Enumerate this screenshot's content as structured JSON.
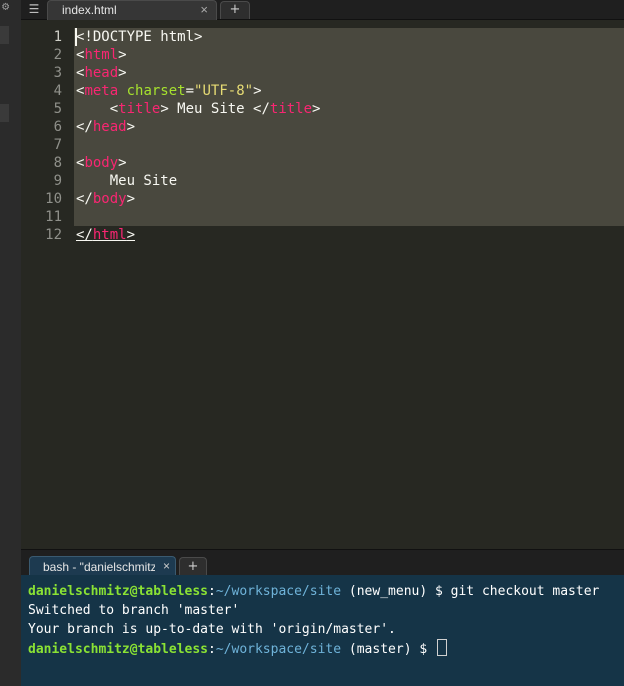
{
  "editor": {
    "tab_label": "index.html",
    "tab_close": "×",
    "new_tab": "+",
    "line_numbers": [
      "1",
      "2",
      "3",
      "4",
      "5",
      "6",
      "7",
      "8",
      "9",
      "10",
      "11",
      "12"
    ],
    "lines": {
      "l1": "<!DOCTYPE html>",
      "l2": {
        "open": "<",
        "tag": "html",
        "close": ">"
      },
      "l3": {
        "open": "<",
        "tag": "head",
        "close": ">"
      },
      "l4": {
        "open": "<",
        "tag": "meta",
        "sp": " ",
        "attr": "charset",
        "eq": "=",
        "str": "\"UTF-8\"",
        "close": ">"
      },
      "l5": {
        "indent": "    ",
        "open": "<",
        "tag": "title",
        "mid": "> Meu Site </",
        "tag2": "title",
        "close": ">"
      },
      "l6": {
        "open": "</",
        "tag": "head",
        "close": ">"
      },
      "l8": {
        "open": "<",
        "tag": "body",
        "close": ">"
      },
      "l9": "    Meu Site",
      "l10": {
        "open": "</",
        "tag": "body",
        "close": ">"
      },
      "l12": {
        "open": "</",
        "tag": "html",
        "close": ">"
      }
    }
  },
  "terminal": {
    "tab_label": "bash - \"danielschmitz",
    "tab_close": "×",
    "new_tab": "+",
    "lines": [
      {
        "user": "danielschmitz@tableless",
        "sep": ":",
        "path": "~/workspace/site",
        "rest": " (new_menu) $ git checkout master"
      },
      {
        "text": "Switched to branch 'master'"
      },
      {
        "text": "Your branch is up-to-date with 'origin/master'."
      },
      {
        "user": "danielschmitz@tableless",
        "sep": ":",
        "path": "~/workspace/site",
        "rest": " (master) $ "
      }
    ]
  },
  "colors": {
    "editor_bg": "#272822",
    "selection": "#49483e",
    "tag": "#f92672",
    "attr": "#a6e22e",
    "string": "#e6db74",
    "terminal_bg": "#153447",
    "terminal_user": "#8ae234",
    "terminal_path": "#6fb3d9"
  },
  "icons": {
    "menu": "list-icon",
    "gear": "gear-icon"
  }
}
